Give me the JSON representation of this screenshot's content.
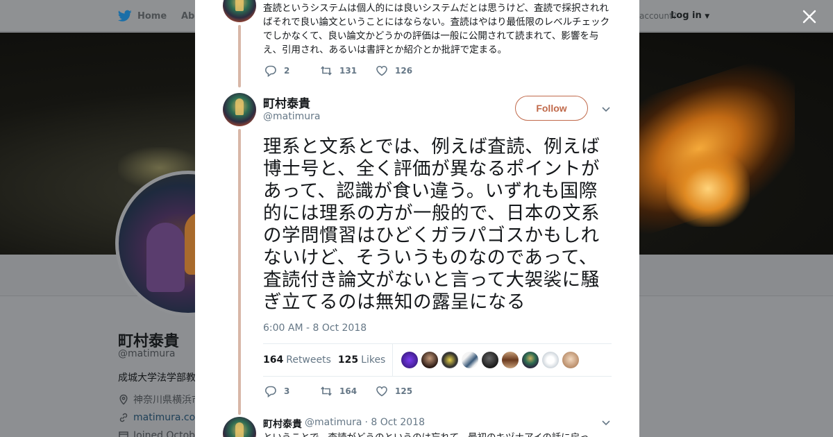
{
  "nav": {
    "home_label": "Home",
    "about_label": "Abo",
    "account_prompt": "account?",
    "login_label": "Log in"
  },
  "profile": {
    "name": "町村泰貴",
    "handle": "@matimura",
    "bio": "成城大学法学部教",
    "location": "神奈川県横浜市",
    "url": "matimura.cocc",
    "joined": "Joined Octob"
  },
  "modal": {
    "previous_tweet": {
      "text": "査読というシステムは個人的には良いシステムだとは思うけど、査読で採択されればそれで良い論文ということにはならない。査読はやはり最低限のレベルチェックでしかなくて、良い論文かどうかの評価は一般に公開されて読まれて、影響を与え、引用され、あるいは書評とか紹介とか批評で定まる。",
      "replies": "2",
      "retweets": "131",
      "likes": "126"
    },
    "main_tweet": {
      "name": "町村泰貴",
      "handle": "@matimura",
      "follow_label": "Follow",
      "text": "理系と文系とでは、例えば査読、例えば博士号と、全く評価が異なるポイントがあって、認識が食い違う。いずれも国際的には理系の方が一般的で、日本の文系の学問慣習はひどくガラパゴスかもしれないけど、そういうものなのであって、査読付き論文がないと言って大袈裟に騒ぎ立てるのは無知の露呈になる",
      "timestamp": "6:00 AM - 8 Oct 2018",
      "retweet_count": "164",
      "retweet_label": "Retweets",
      "like_count": "125",
      "like_label": "Likes",
      "replies": "3",
      "retweets": "164",
      "likes": "125"
    },
    "next_tweet": {
      "name": "町村泰貴",
      "handle": "@matimura",
      "date": "· 8 Oct 2018",
      "text": "ということで、査読がどうのというのは忘れて、最初のキヅナアイの話に戻っ"
    }
  },
  "colors": {
    "accent": "#c0694a",
    "thread_line": "#d8b7a7",
    "muted": "#657786",
    "twitter_bird": "#1da1f2"
  },
  "icons": {
    "home": "twitter-bird-icon",
    "close": "close-icon",
    "reply": "reply-icon",
    "retweet": "retweet-icon",
    "like": "heart-icon",
    "menu": "chevron-down-icon",
    "location": "location-pin-icon",
    "link": "link-icon",
    "calendar": "calendar-icon"
  }
}
